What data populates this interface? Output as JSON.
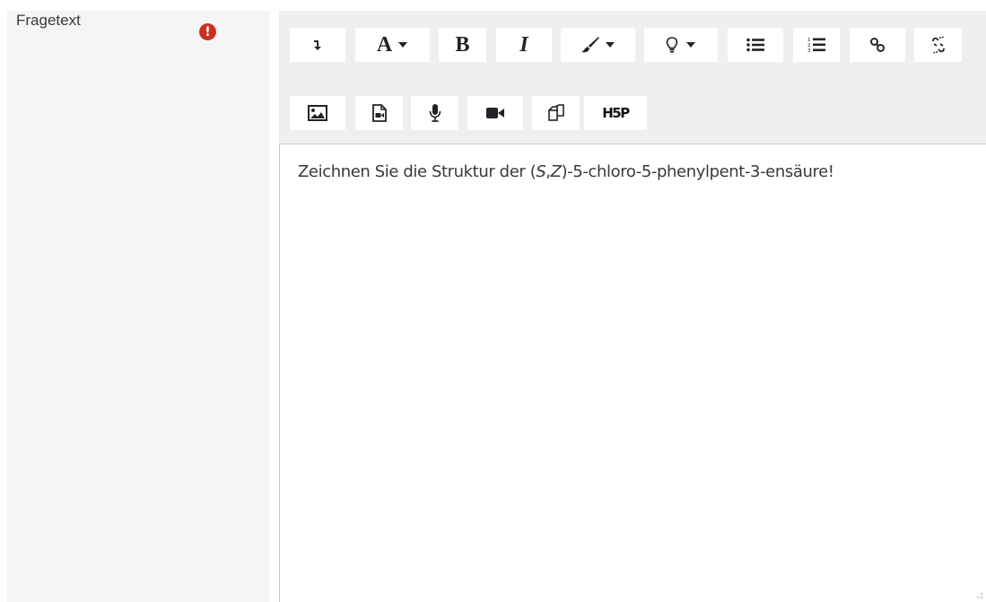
{
  "field": {
    "label": "Fragetext",
    "required_icon": "exclamation-circle-icon",
    "required_color": "#ca3120"
  },
  "toolbar": {
    "row1": [
      {
        "name": "show-more-buttons-button",
        "icon": "arrow-down-icon"
      },
      {
        "name": "font-size-button",
        "icon": "font-size-icon",
        "text": "A"
      },
      {
        "name": "bold-button",
        "icon": "bold-icon",
        "text": "B"
      },
      {
        "name": "italic-button",
        "icon": "italic-icon",
        "text": "I"
      },
      {
        "name": "text-color-button",
        "icon": "paintbrush-icon"
      },
      {
        "name": "highlight-button",
        "icon": "lightbulb-icon"
      },
      {
        "name": "unordered-list-button",
        "icon": "bullet-list-icon"
      },
      {
        "name": "ordered-list-button",
        "icon": "numbered-list-icon"
      },
      {
        "name": "link-button",
        "icon": "link-icon"
      },
      {
        "name": "unlink-button",
        "icon": "unlink-icon"
      }
    ],
    "row2": [
      {
        "name": "insert-image-button",
        "icon": "image-icon"
      },
      {
        "name": "insert-media-button",
        "icon": "file-media-icon"
      },
      {
        "name": "record-audio-button",
        "icon": "microphone-icon"
      },
      {
        "name": "record-video-button",
        "icon": "video-camera-icon"
      },
      {
        "name": "manage-files-button",
        "icon": "copy-files-icon"
      },
      {
        "name": "h5p-button",
        "icon": "h5p-logo-icon",
        "text": "H5P"
      }
    ]
  },
  "content": {
    "before": "Zeichnen Sie die Struktur der (",
    "stereo_s": "S",
    "comma": ",",
    "stereo_z": "Z",
    "after": ")-5-chloro-5-phenylpent-3-ensäure!"
  }
}
